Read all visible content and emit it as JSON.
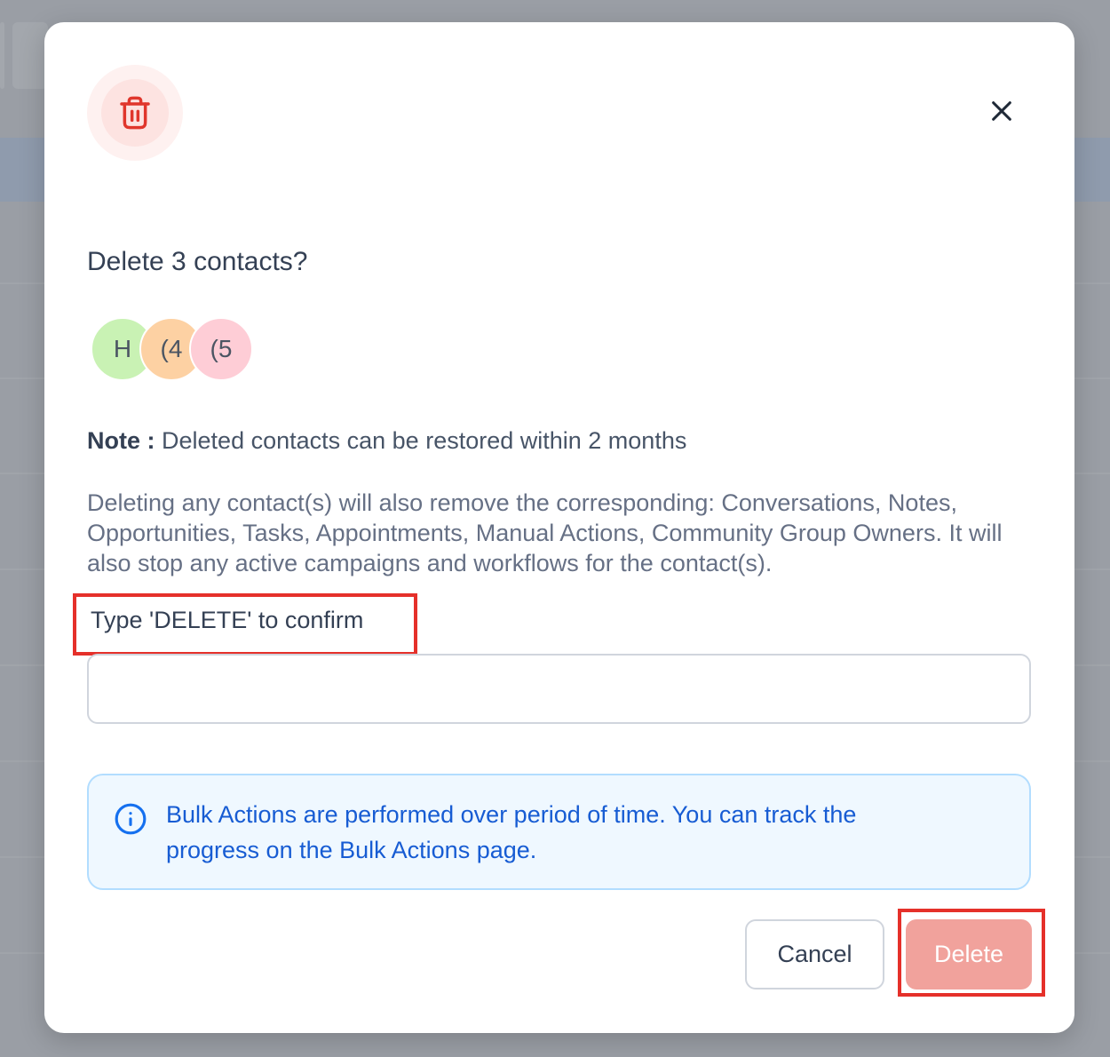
{
  "modal": {
    "title": "Delete 3 contacts?",
    "avatars": [
      {
        "initials": "H",
        "color": "#c9f2b4"
      },
      {
        "initials": "(4",
        "color": "#fdd1a3"
      },
      {
        "initials": "(5",
        "color": "#fecdd6"
      }
    ],
    "note_label": "Note :",
    "note_text": "Deleted contacts can be restored within 2 months",
    "description": "Deleting any contact(s) will also remove the corresponding: Conversations, Notes, Opportunities, Tasks, Appointments, Manual Actions, Community Group Owners. It will also stop any active campaigns and workflows for the contact(s).",
    "confirm_label": "Type 'DELETE' to confirm",
    "confirm_value": "",
    "confirm_placeholder": "",
    "info_text": "Bulk Actions are performed over period of time. You can track the progress on the Bulk Actions page.",
    "cancel_label": "Cancel",
    "delete_label": "Delete"
  },
  "icons": {
    "header": "trash-icon",
    "close": "close-icon",
    "info": "info-icon"
  },
  "colors": {
    "danger": "#e0362c",
    "danger_soft": "#f1a29c",
    "info_text": "#175cd3",
    "info_bg": "#eff8ff",
    "highlight": "#e5302a"
  }
}
